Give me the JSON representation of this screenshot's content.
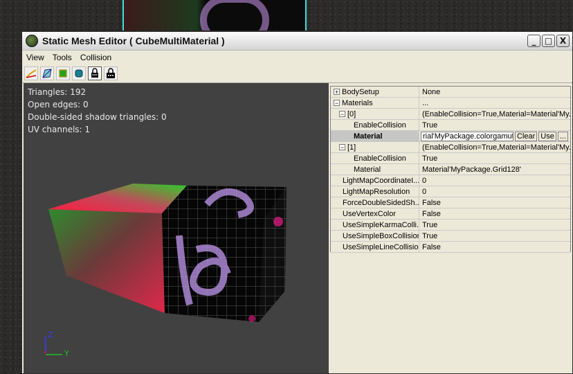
{
  "window": {
    "title": "Static Mesh Editor ( CubeMultiMaterial )",
    "min_glyph": "_",
    "max_glyph": "□",
    "close_glyph": "X"
  },
  "menu": [
    "View",
    "Tools",
    "Collision"
  ],
  "toolbar": {
    "icons": [
      "wireframe-icon",
      "bounds-icon",
      "green-square-icon",
      "collision-icon",
      "lock-icon",
      "padlock-icon"
    ]
  },
  "viewport": {
    "stats": {
      "triangles": "Triangles:  192",
      "open_edges": "Open edges:  0",
      "shadow_tris": "Double-sided shadow triangles:  0",
      "uv_channels": "UV channels:  1"
    },
    "axis": {
      "z": "Z",
      "y": "Y"
    }
  },
  "properties": {
    "rows": [
      {
        "name": "BodySetup",
        "value": "None",
        "expander": "+"
      },
      {
        "name": "Materials",
        "value": "...",
        "expander": "−"
      },
      {
        "name": "[0]",
        "value": "(EnableCollision=True,Material=Material'My...",
        "expander": "−"
      },
      {
        "name": "EnableCollision",
        "value": "True"
      },
      {
        "name": "Material",
        "value": "rial'MyPackage.colorgamut'",
        "selected": true,
        "clear": "Clear",
        "use": "Use",
        "browse": "..."
      },
      {
        "name": "[1]",
        "value": "(EnableCollision=True,Material=Material'My...",
        "expander": "−"
      },
      {
        "name": "EnableCollision",
        "value": "True"
      },
      {
        "name": "Material",
        "value": "Material'MyPackage.Grid128'"
      },
      {
        "name": "LightMapCoordinateI...",
        "value": "0"
      },
      {
        "name": "LightMapResolution",
        "value": "0"
      },
      {
        "name": "ForceDoubleSidedSh...",
        "value": "False"
      },
      {
        "name": "UseVertexColor",
        "value": "False"
      },
      {
        "name": "UseSimpleKarmaColli...",
        "value": "True"
      },
      {
        "name": "UseSimpleBoxCollision",
        "value": "True"
      },
      {
        "name": "UseSimpleLineCollision",
        "value": "False"
      }
    ]
  },
  "colors": {
    "accent_cyan": "#39e0e0",
    "viewport_bg": "#414141",
    "panel_bg": "#ece9d8"
  }
}
